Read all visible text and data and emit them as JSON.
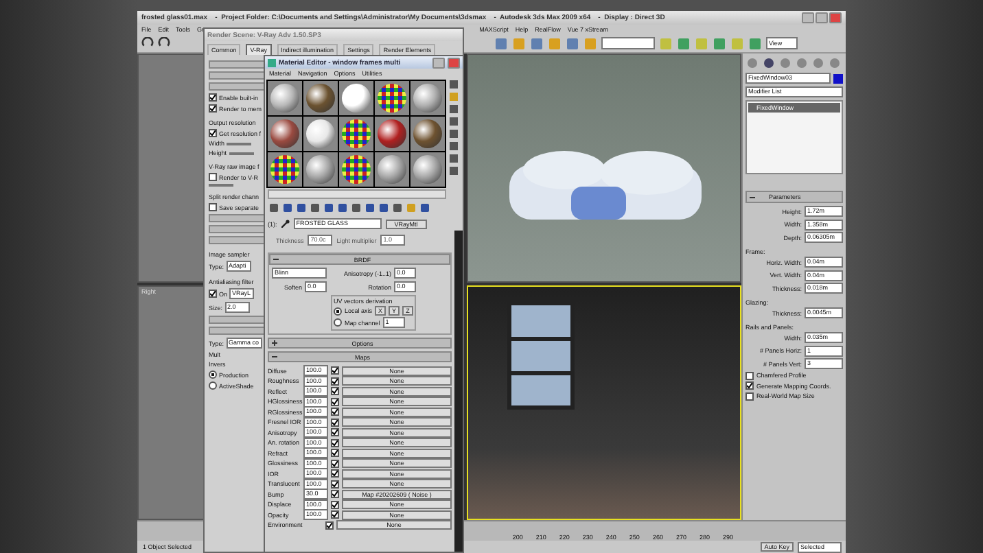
{
  "window": {
    "title": "frosted glass01.max    -  Project Folder: C:\\Documents and Settings\\Administrator\\My Documents\\3dsmax    -  Autodesk 3ds Max 2009 x64    -  Display : Direct 3D"
  },
  "menu_left": [
    "File",
    "Edit",
    "Tools",
    "Gr"
  ],
  "menu_right": [
    "MAXScript",
    "Help",
    "RealFlow",
    "Vue 7 xStream"
  ],
  "toolbar": {
    "view_dropdown": "View"
  },
  "viewports": [
    {
      "active": false
    },
    {
      "active": false
    },
    {
      "label": "Right",
      "active": false
    },
    {
      "active": true
    }
  ],
  "render_dialog": {
    "title": "Render Scene: V-Ray Adv 1.50.SP3",
    "tabs": [
      {
        "label": "Common",
        "selected": false
      },
      {
        "label": "V-Ray",
        "selected": true
      },
      {
        "label": "Indirect illumination",
        "selected": false
      },
      {
        "label": "Settings",
        "selected": false
      },
      {
        "label": "Render Elements",
        "selected": false
      }
    ],
    "items": [
      {
        "kind": "bar"
      },
      {
        "kind": "bar"
      },
      {
        "kind": "bar"
      },
      {
        "kind": "checkbox",
        "label": "Enable built-in",
        "checked": true
      },
      {
        "kind": "checkbox",
        "label": "Render to mem",
        "checked": true
      },
      {
        "kind": "group",
        "label": "Output resolution"
      },
      {
        "kind": "checkbox",
        "label": "Get resolution f",
        "checked": true
      },
      {
        "kind": "field",
        "label": "Width"
      },
      {
        "kind": "field",
        "label": "Height"
      },
      {
        "kind": "group",
        "label": "V-Ray raw image f"
      },
      {
        "kind": "checkbox",
        "label": "Render to V-R",
        "checked": false
      },
      {
        "kind": "field"
      },
      {
        "kind": "group",
        "label": "Split render chann"
      },
      {
        "kind": "checkbox",
        "label": "Save separate",
        "checked": false
      },
      {
        "kind": "bar"
      },
      {
        "kind": "bar"
      },
      {
        "kind": "bar"
      },
      {
        "kind": "group",
        "label": "Image sampler"
      },
      {
        "kind": "field",
        "label": "Type:",
        "value": "Adapti"
      },
      {
        "kind": "group",
        "label": "Antialiasing filter"
      },
      {
        "kind": "checkbox",
        "label": "On",
        "checked": true,
        "value": "VRayL"
      },
      {
        "kind": "field",
        "label": "Size:",
        "value": "2.0"
      },
      {
        "kind": "bar"
      },
      {
        "kind": "bar"
      },
      {
        "kind": "field",
        "label": "Type:",
        "value": "Gamma co"
      },
      {
        "kind": "text",
        "label": "Mult"
      },
      {
        "kind": "text",
        "label": "Invers"
      },
      {
        "kind": "radio",
        "label": "Production",
        "selected": true
      },
      {
        "kind": "radio",
        "label": "ActiveShade",
        "selected": false
      }
    ]
  },
  "material_editor": {
    "title": "Material Editor - window frames multi",
    "menu": [
      "Material",
      "Navigation",
      "Options",
      "Utilities"
    ],
    "slot_label": "(1):",
    "material_name": "FROSTED GLASS",
    "material_type": "VRayMtl",
    "faded_fields": [
      {
        "label": "Thickness",
        "value": "70.0c"
      },
      {
        "label": "Light multiplier",
        "value": "1.0"
      }
    ],
    "brdf": {
      "title": "BRDF",
      "expanded": true,
      "type": "Blinn",
      "soften_label": "Soften",
      "soften": "0.0",
      "anisotropy_label": "Anisotropy (-1..1)",
      "anisotropy": "0.0",
      "rotation_label": "Rotation",
      "rotation": "0.0",
      "uv_group": "UV vectors derivation",
      "options": [
        {
          "label": "Local axis",
          "selected": true,
          "axes": [
            "X",
            "Y",
            "Z"
          ]
        },
        {
          "label": "Map channel",
          "selected": false,
          "value": "1"
        }
      ]
    },
    "options_rollout": {
      "title": "Options",
      "expanded": false
    },
    "maps": {
      "title": "Maps",
      "expanded": true,
      "rows": [
        {
          "name": "Diffuse",
          "value": "100.0",
          "checked": true,
          "map": "None"
        },
        {
          "name": "Roughness",
          "value": "100.0",
          "checked": true,
          "map": "None"
        },
        {
          "name": "Reflect",
          "value": "100.0",
          "checked": true,
          "map": "None"
        },
        {
          "name": "HGlossiness",
          "value": "100.0",
          "checked": true,
          "map": "None"
        },
        {
          "name": "RGlossiness",
          "value": "100.0",
          "checked": true,
          "map": "None"
        },
        {
          "name": "Fresnel IOR",
          "value": "100.0",
          "checked": true,
          "map": "None"
        },
        {
          "name": "Anisotropy",
          "value": "100.0",
          "checked": true,
          "map": "None"
        },
        {
          "name": "An. rotation",
          "value": "100.0",
          "checked": true,
          "map": "None"
        },
        {
          "name": "Refract",
          "value": "100.0",
          "checked": true,
          "map": "None"
        },
        {
          "name": "Glossiness",
          "value": "100.0",
          "checked": true,
          "map": "None"
        },
        {
          "name": "IOR",
          "value": "100.0",
          "checked": true,
          "map": "None"
        },
        {
          "name": "Translucent",
          "value": "100.0",
          "checked": true,
          "map": "None"
        },
        {
          "name": "Bump",
          "value": "30.0",
          "checked": true,
          "map": "Map #20202609 ( Noise )"
        },
        {
          "name": "Displace",
          "value": "100.0",
          "checked": true,
          "map": "None"
        },
        {
          "name": "Opacity",
          "value": "100.0",
          "checked": true,
          "map": "None"
        },
        {
          "name": "Environment",
          "checked": true,
          "map": "None"
        }
      ]
    }
  },
  "command_panel": {
    "object_name": "FixedWindow03",
    "modifier_list": "Modifier List",
    "stack": [
      {
        "label": "FixedWindow",
        "selected": true
      }
    ],
    "rollout": {
      "title": "Parameters",
      "expanded": true
    },
    "params": [
      {
        "kind": "field",
        "label": "Height:",
        "value": "1.72m"
      },
      {
        "kind": "field",
        "label": "Width:",
        "value": "1.358m"
      },
      {
        "kind": "field",
        "label": "Depth:",
        "value": "0.06305m"
      },
      {
        "kind": "group",
        "label": "Frame:"
      },
      {
        "kind": "field",
        "label": "Horiz. Width:",
        "value": "0.04m"
      },
      {
        "kind": "field",
        "label": "Vert. Width:",
        "value": "0.04m"
      },
      {
        "kind": "field",
        "label": "Thickness:",
        "value": "0.018m"
      },
      {
        "kind": "group",
        "label": "Glazing:"
      },
      {
        "kind": "field",
        "label": "Thickness:",
        "value": "0.0045m"
      },
      {
        "kind": "group",
        "label": "Rails and Panels:"
      },
      {
        "kind": "field",
        "label": "Width:",
        "value": "0.035m"
      },
      {
        "kind": "field",
        "label": "# Panels Horiz:",
        "value": "1"
      },
      {
        "kind": "field",
        "label": "# Panels Vert:",
        "value": "3"
      },
      {
        "kind": "checkbox",
        "label": "Chamfered Profile",
        "checked": false
      },
      {
        "kind": "checkbox",
        "label": "Generate Mapping Coords.",
        "checked": true
      },
      {
        "kind": "checkbox",
        "label": "Real-World Map Size",
        "checked": false
      }
    ]
  },
  "timeline": {
    "ticks": [
      "200",
      "210",
      "220",
      "230",
      "240",
      "250",
      "260",
      "270",
      "280",
      "290"
    ]
  },
  "status_bar": {
    "selection": "1 Object Selected",
    "auto_key": "Auto Key",
    "key_filter": "Selected"
  }
}
